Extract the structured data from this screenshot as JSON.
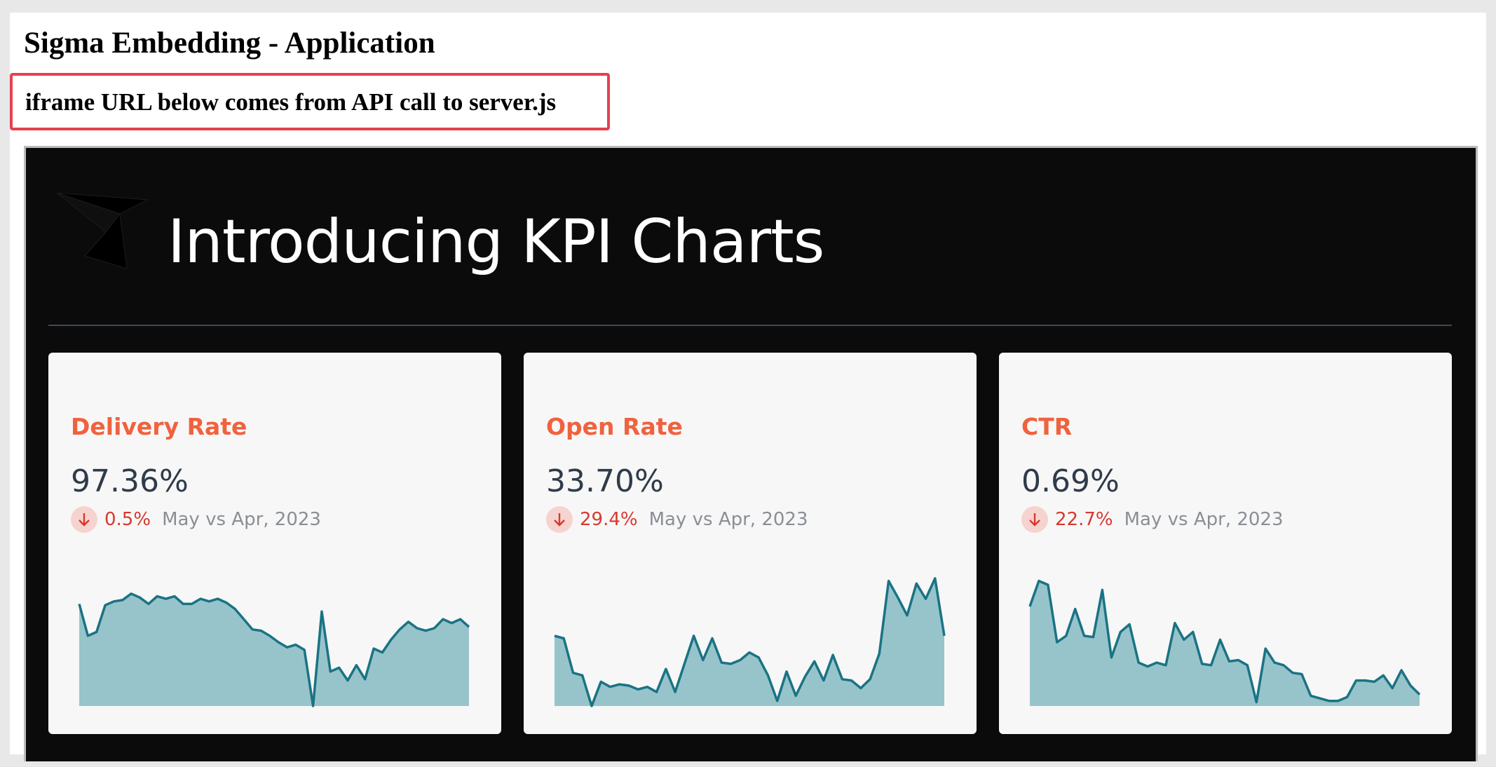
{
  "app": {
    "title": "Sigma Embedding - Application",
    "note": "iframe URL below comes from API call to server.js"
  },
  "dashboard": {
    "title": "Introducing KPI Charts",
    "accent_color": "#f0623e",
    "line_color": "#1a7384",
    "fill_color": "#97c4ca",
    "kpis": [
      {
        "title": "Delivery Rate",
        "value": "97.36%",
        "change": "0.5%",
        "direction": "down",
        "period": "May vs Apr, 2023",
        "sparkline": [
          0.8,
          0.55,
          0.58,
          0.79,
          0.82,
          0.83,
          0.88,
          0.85,
          0.8,
          0.86,
          0.84,
          0.86,
          0.8,
          0.8,
          0.84,
          0.82,
          0.84,
          0.81,
          0.76,
          0.68,
          0.6,
          0.59,
          0.55,
          0.5,
          0.46,
          0.48,
          0.44,
          0.0,
          0.74,
          0.27,
          0.3,
          0.2,
          0.32,
          0.21,
          0.45,
          0.42,
          0.52,
          0.6,
          0.66,
          0.61,
          0.59,
          0.61,
          0.68,
          0.65,
          0.68,
          0.62
        ]
      },
      {
        "title": "Open Rate",
        "value": "33.70%",
        "change": "29.4%",
        "direction": "down",
        "period": "May vs Apr, 2023",
        "sparkline": [
          0.55,
          0.53,
          0.26,
          0.24,
          0.0,
          0.19,
          0.15,
          0.17,
          0.16,
          0.13,
          0.15,
          0.11,
          0.29,
          0.11,
          0.33,
          0.55,
          0.36,
          0.53,
          0.34,
          0.33,
          0.36,
          0.42,
          0.38,
          0.24,
          0.04,
          0.27,
          0.08,
          0.23,
          0.35,
          0.2,
          0.4,
          0.21,
          0.2,
          0.14,
          0.21,
          0.41,
          0.98,
          0.85,
          0.71,
          0.96,
          0.84,
          1.0,
          0.55
        ]
      },
      {
        "title": "CTR",
        "value": "0.69%",
        "change": "22.7%",
        "direction": "down",
        "period": "May vs Apr, 2023",
        "sparkline": [
          0.78,
          0.98,
          0.95,
          0.5,
          0.55,
          0.76,
          0.55,
          0.54,
          0.91,
          0.38,
          0.58,
          0.64,
          0.34,
          0.31,
          0.34,
          0.32,
          0.65,
          0.52,
          0.58,
          0.33,
          0.32,
          0.52,
          0.35,
          0.36,
          0.32,
          0.03,
          0.45,
          0.34,
          0.32,
          0.26,
          0.25,
          0.08,
          0.06,
          0.04,
          0.04,
          0.07,
          0.2,
          0.2,
          0.19,
          0.24,
          0.14,
          0.28,
          0.16,
          0.09
        ]
      }
    ]
  }
}
